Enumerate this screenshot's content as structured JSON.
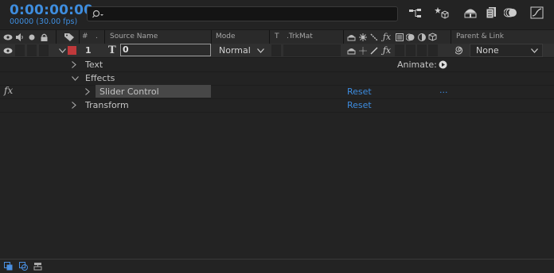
{
  "header": {
    "timecode": "0:00:00:00",
    "fps": "00000 (30.00 fps)",
    "search_placeholder": ""
  },
  "columns": {
    "hash": "#",
    "source_name": "Source Name",
    "mode": "Mode",
    "t": "T",
    "trkmat": ".TrkMat",
    "parent_link": "Parent & Link"
  },
  "layer": {
    "index": "1",
    "type_glyph": "T",
    "name": "0",
    "mode": "Normal",
    "parent": "None",
    "label_color": "#c0393b"
  },
  "tree": {
    "text": "Text",
    "animate": "Animate:",
    "effects": "Effects",
    "slider_control": "Slider Control",
    "reset_1": "Reset",
    "dots": "...",
    "transform": "Transform",
    "reset_2": "Reset",
    "fx_glyph": "fx"
  },
  "colors": {
    "accent_blue": "#3d8ce0",
    "background": "#232323"
  }
}
